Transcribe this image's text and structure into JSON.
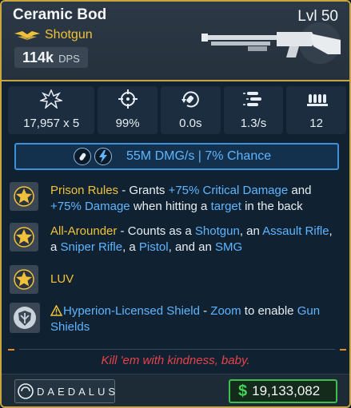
{
  "item": {
    "name": "Ceramic Bod",
    "level": "Lvl 50",
    "type": "Shotgun",
    "dps_value": "114k",
    "dps_unit": "DPS",
    "rarity_icon": "legendary-wings-icon",
    "weapon_icon": "shotgun-silhouette"
  },
  "stats": [
    {
      "icon": "damage-burst-icon",
      "value": "17,957 x 5"
    },
    {
      "icon": "crosshair-icon",
      "value": "99%"
    },
    {
      "icon": "reload-icon",
      "value": "0.0s"
    },
    {
      "icon": "fire-rate-icon",
      "value": "1.3/s"
    },
    {
      "icon": "magazine-icon",
      "value": "12"
    }
  ],
  "elemental": {
    "icons": [
      "ammo-bullet-icon",
      "shock-lightning-icon"
    ],
    "text": "55M DMG/s | 7% Chance"
  },
  "perks": [
    {
      "icon": "legendary-star-icon",
      "name": "Prison Rules",
      "parts": [
        " - Grants ",
        "+75% Critical Damage",
        " and ",
        "+75% Damage",
        " when hitting a ",
        "target",
        " in the back"
      ]
    },
    {
      "icon": "legendary-star-icon",
      "name": "All-Arounder",
      "parts": [
        " - Counts as a ",
        "Shotgun",
        ", an ",
        "Assault Rifle",
        ", a ",
        "Sniper Rifle",
        ", a ",
        "Pistol",
        ", and an ",
        "SMG"
      ]
    },
    {
      "icon": "legendary-star-icon",
      "name": "LUV",
      "parts": []
    },
    {
      "icon": "hyperion-shield-icon",
      "warning_icon": "warning-triangle-icon",
      "parts": [
        "Hyperion-Licensed Shield",
        " - ",
        "Zoom",
        " to enable ",
        "Gun Shields"
      ]
    }
  ],
  "flavor_text": "Kill 'em with kindness, baby.",
  "manufacturer": "DAEDALUS",
  "currency_symbol": "$",
  "value": "19,133,082",
  "colors": {
    "legendary_gold": "#c9a640",
    "type_yellow": "#f0c23a",
    "highlight_blue": "#5fb5ff",
    "flavor_red": "#e5424a",
    "money_green": "#45d258",
    "element_border": "#3f8fd9"
  }
}
